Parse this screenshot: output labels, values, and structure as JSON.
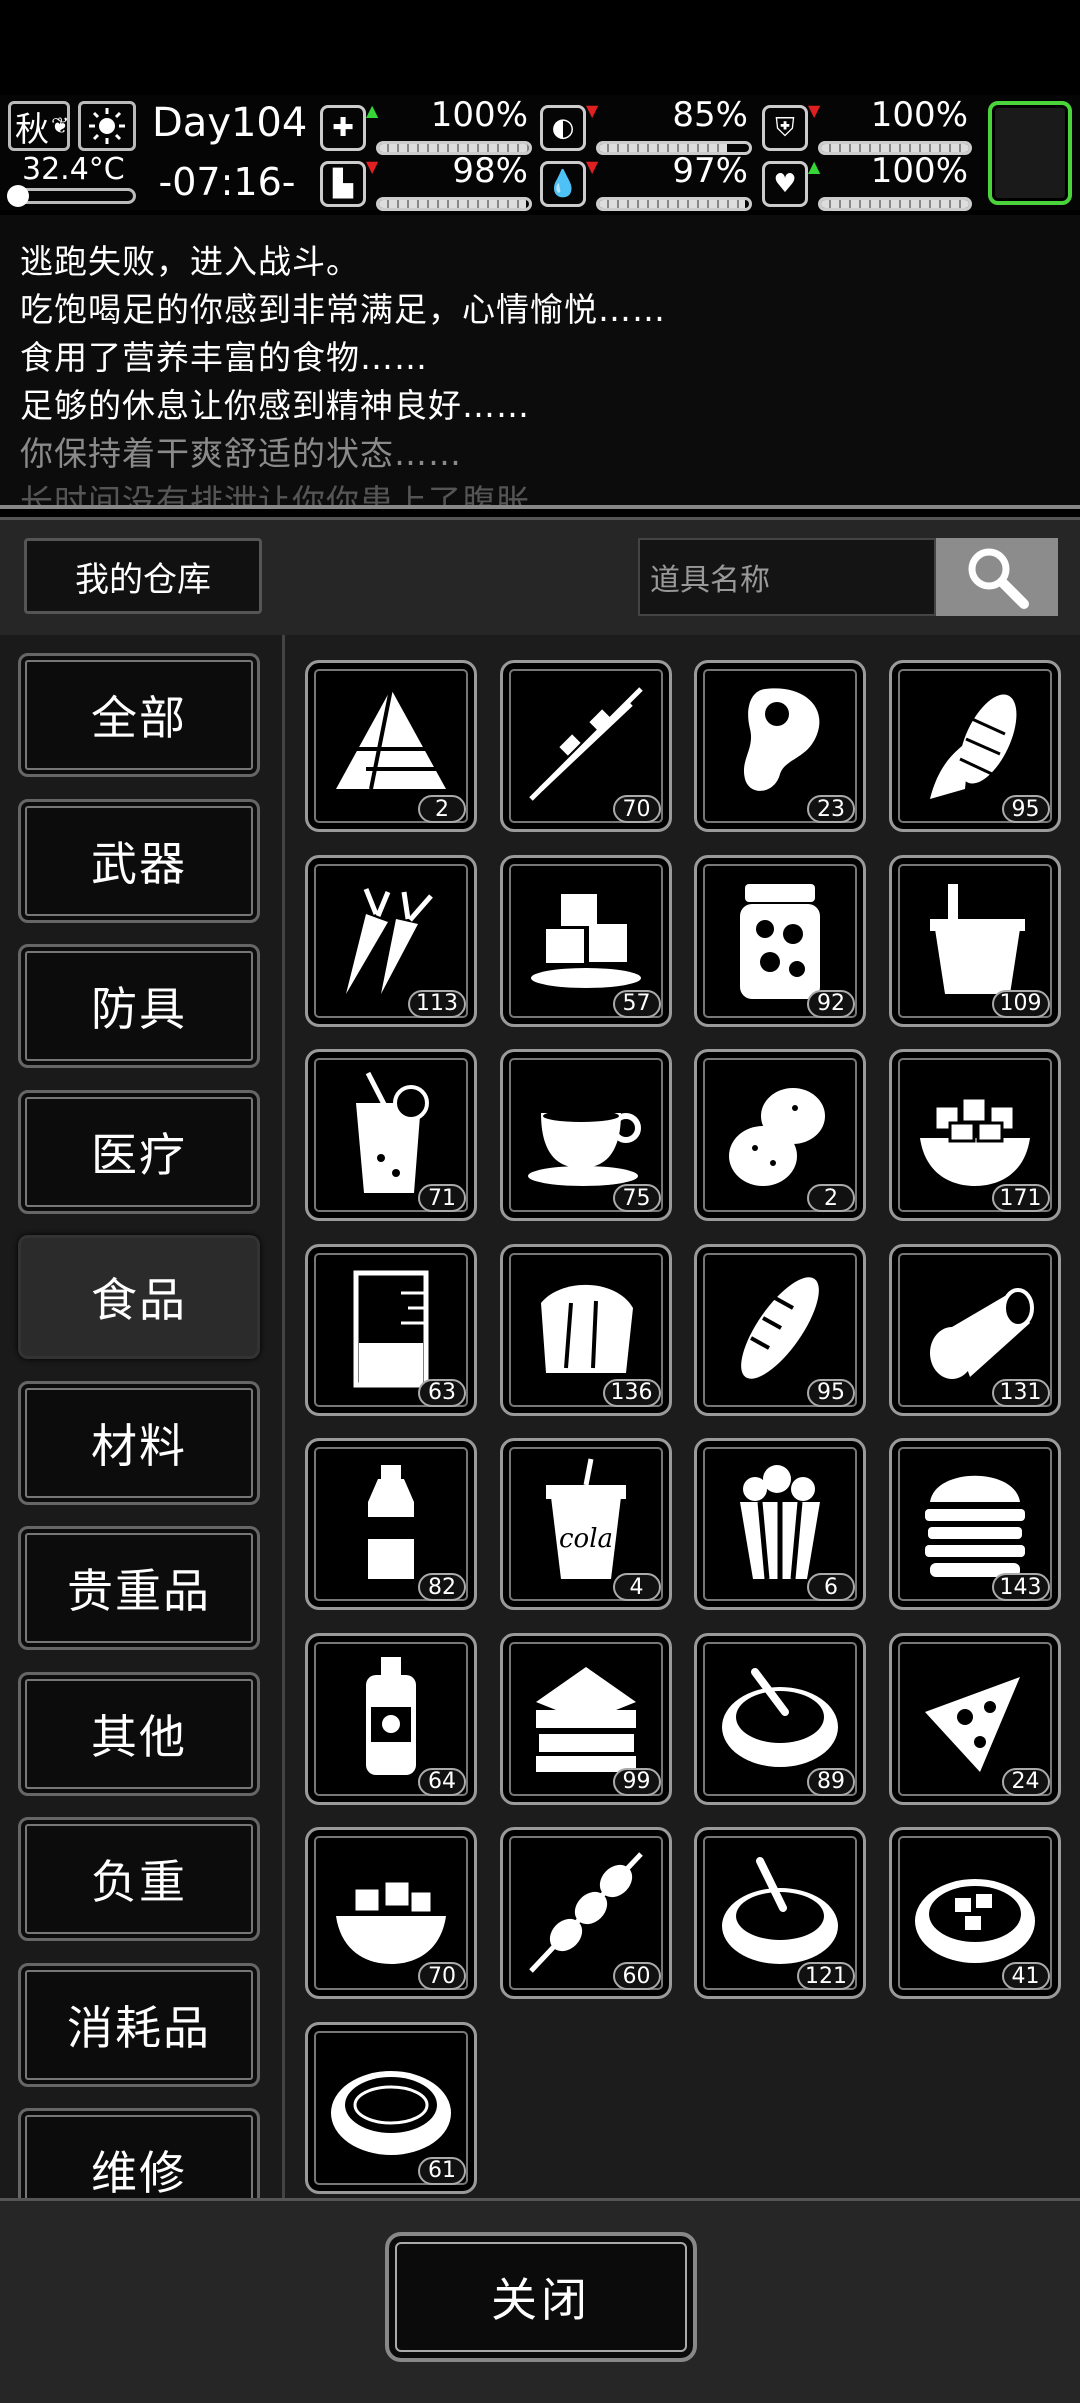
{
  "hud": {
    "season": "秋",
    "temperature": "32.4°C",
    "day": "Day104",
    "time": "-07:16-",
    "stats": [
      {
        "icon": "medkit-icon",
        "trend": "up",
        "value": "100%",
        "level": 1.0
      },
      {
        "icon": "stomach-icon",
        "trend": "down",
        "value": "85%",
        "level": 0.85
      },
      {
        "icon": "shield-icon",
        "trend": "down",
        "value": "100%",
        "level": 1.0
      },
      {
        "icon": "boot-icon",
        "trend": "down",
        "value": "98%",
        "level": 0.98
      },
      {
        "icon": "water-drop-icon",
        "trend": "down",
        "value": "97%",
        "level": 0.97
      },
      {
        "icon": "heart-icon",
        "trend": "up",
        "value": "100%",
        "level": 1.0
      }
    ],
    "colors": {
      "up": "#35d635",
      "down": "#e02020",
      "map_border": "#4bd33b"
    }
  },
  "log": [
    "逃跑失败，进入战斗。",
    "吃饱喝足的你感到非常满足，心情愉悦……",
    "食用了营养丰富的食物……",
    "足够的休息让你感到精神良好……",
    "你保持着干爽舒适的状态……",
    "长时间没有排泄让你你患上了腹胀"
  ],
  "warehouse": {
    "title": "我的仓库",
    "search_placeholder": "道具名称"
  },
  "categories": [
    {
      "label": "全部",
      "active": false
    },
    {
      "label": "武器",
      "active": false
    },
    {
      "label": "防具",
      "active": false
    },
    {
      "label": "医疗",
      "active": false
    },
    {
      "label": "食品",
      "active": true
    },
    {
      "label": "材料",
      "active": false
    },
    {
      "label": "贵重品",
      "active": false
    },
    {
      "label": "其他",
      "active": false
    },
    {
      "label": "负重",
      "active": false
    },
    {
      "label": "消耗品",
      "active": false
    },
    {
      "label": "维修",
      "active": false
    }
  ],
  "items": [
    {
      "icon": "rice-dumpling-icon",
      "count": "2"
    },
    {
      "icon": "skewer-icon",
      "count": "70"
    },
    {
      "icon": "meat-icon",
      "count": "23"
    },
    {
      "icon": "corn-icon",
      "count": "95"
    },
    {
      "icon": "carrot-icon",
      "count": "113"
    },
    {
      "icon": "ice-cubes-icon",
      "count": "57"
    },
    {
      "icon": "pickle-jar-icon",
      "count": "92"
    },
    {
      "icon": "bucket-icon",
      "count": "109"
    },
    {
      "icon": "juice-icon",
      "count": "71"
    },
    {
      "icon": "coffee-cup-icon",
      "count": "75"
    },
    {
      "icon": "potato-icon",
      "count": "2"
    },
    {
      "icon": "tofu-bowl-icon",
      "count": "171"
    },
    {
      "icon": "beaker-icon",
      "count": "63"
    },
    {
      "icon": "bread-roll-icon",
      "count": "136"
    },
    {
      "icon": "baguette-icon",
      "count": "95"
    },
    {
      "icon": "canned-food-icon",
      "count": "131"
    },
    {
      "icon": "water-bottle-icon",
      "count": "82"
    },
    {
      "icon": "cola-cup-icon",
      "count": "4",
      "text": "cola"
    },
    {
      "icon": "popcorn-icon",
      "count": "6"
    },
    {
      "icon": "burger-icon",
      "count": "143"
    },
    {
      "icon": "sauce-bottle-icon",
      "count": "64"
    },
    {
      "icon": "sandwich-icon",
      "count": "99"
    },
    {
      "icon": "soup-bowl-icon",
      "count": "89"
    },
    {
      "icon": "pizza-slice-icon",
      "count": "24"
    },
    {
      "icon": "food-bowl-icon",
      "count": "70"
    },
    {
      "icon": "kebab-icon",
      "count": "60"
    },
    {
      "icon": "stew-pot-icon",
      "count": "121"
    },
    {
      "icon": "hotpot-icon",
      "count": "41"
    },
    {
      "icon": "porridge-bowl-icon",
      "count": "61"
    }
  ],
  "close_label": "关闭"
}
